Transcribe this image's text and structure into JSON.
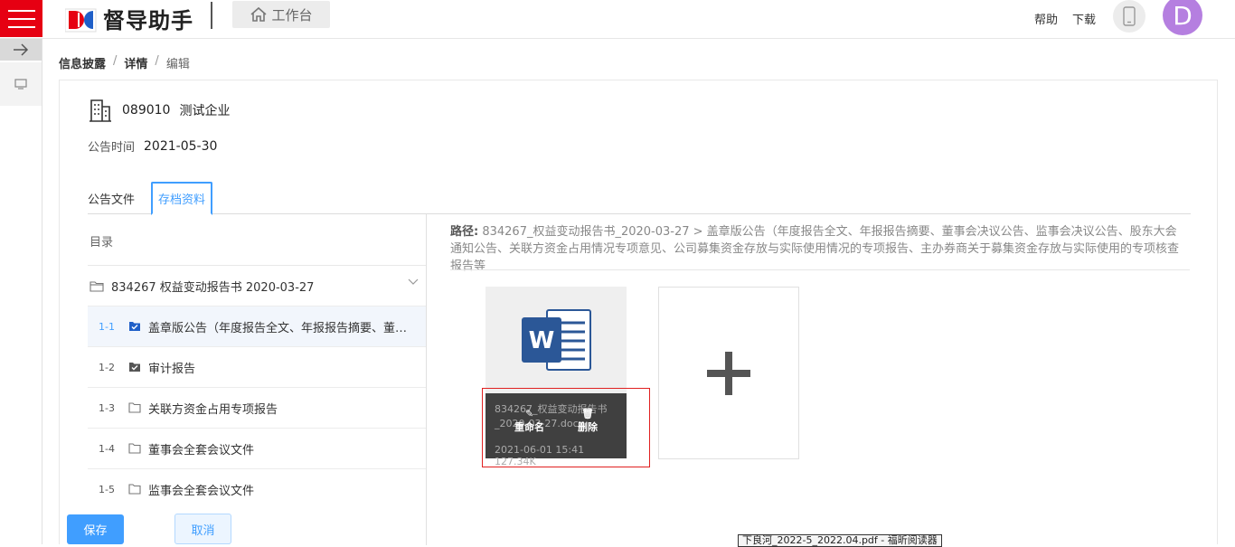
{
  "header": {
    "logo_text": "督导助手",
    "workbench_label": "工作台",
    "help_label": "帮助",
    "download_label": "下载",
    "avatar_letter": "D",
    "brand_red": "#e60012",
    "avatar_color": "#b57fe0"
  },
  "breadcrumb": {
    "level1": "信息披露",
    "level2": "详情",
    "level3": "编辑"
  },
  "enterprise": {
    "code": "089010",
    "name": "测试企业",
    "date_label": "公告时间",
    "date_value": "2021-05-30"
  },
  "tabs": [
    {
      "label": "公告文件"
    },
    {
      "label": "存档资料"
    }
  ],
  "tree": {
    "heading": "目录",
    "root_label": "834267  权益变动报告书  2020-03-27",
    "items": [
      {
        "num": "1-1",
        "label": "盖章版公告（年度报告全文、年报报告摘要、董事会决议公告、监事会决议公告、股东大会通知公告）",
        "icon": "checked-folder-icon",
        "active": true
      },
      {
        "num": "1-2",
        "label": "审计报告",
        "icon": "checked-folder-icon"
      },
      {
        "num": "1-3",
        "label": "关联方资金占用专项报告",
        "icon": "folder-icon"
      },
      {
        "num": "1-4",
        "label": "董事会全套会议文件",
        "icon": "folder-icon"
      },
      {
        "num": "1-5",
        "label": "监事会全套会议文件",
        "icon": "folder-icon"
      }
    ]
  },
  "path": {
    "label": "路径:",
    "value": "834267_权益变动报告书_2020-03-27 > 盖章版公告（年度报告全文、年报报告摘要、董事会决议公告、监事会决议公告、股东大会通知公告、关联方资金占用情况专项意见、公司募集资金存放与实际使用情况的专项报告、主办券商关于募集资金存放与实际使用的专项核查报告等"
  },
  "file": {
    "name": "834267_权益变动报告书_2020-03-27.docx",
    "meta": "2021-06-01 15:41  127.34K",
    "rename_label": "重命名",
    "delete_label": "删除"
  },
  "footer": {
    "save_label": "保存",
    "cancel_label": "取消",
    "tip": "下良河_2022-5_2022.04.pdf - 福昕阅读器"
  }
}
